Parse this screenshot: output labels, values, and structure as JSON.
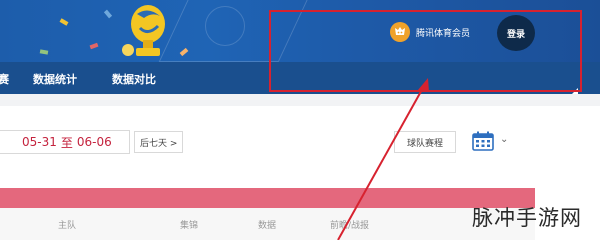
{
  "header": {
    "member_label": "腾讯体育会员",
    "login_label": "登录"
  },
  "nav": {
    "items": [
      {
        "label": "赛"
      },
      {
        "label": "数据统计"
      },
      {
        "label": "数据对比"
      }
    ]
  },
  "toolbar": {
    "date_start": "05-31",
    "date_separator": "至",
    "date_end": "06-06",
    "next_week_label": "后七天 >",
    "schedule_label": "球队赛程"
  },
  "table": {
    "headers": [
      "主队",
      "集锦",
      "数据",
      "前瞻/战报"
    ]
  },
  "watermark": "脉冲手游网",
  "colors": {
    "banner": "#1f64b5",
    "nav": "#1a4f8e",
    "accent_red": "#c4233e",
    "pink_bar": "#e4687d",
    "annotation": "#d7222f",
    "member_icon": "#f0a22a"
  }
}
